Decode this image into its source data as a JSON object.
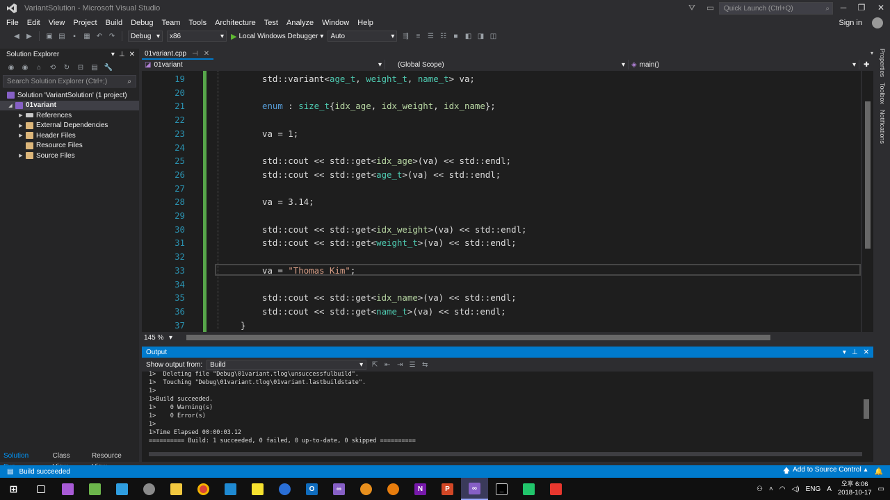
{
  "window": {
    "title": "VariantSolution - Microsoft Visual Studio",
    "quick_launch_placeholder": "Quick Launch (Ctrl+Q)",
    "sign_in": "Sign in"
  },
  "menu": [
    "File",
    "Edit",
    "View",
    "Project",
    "Build",
    "Debug",
    "Team",
    "Tools",
    "Architecture",
    "Test",
    "Analyze",
    "Window",
    "Help"
  ],
  "toolbar": {
    "configuration": "Debug",
    "platform": "x86",
    "debugger": "Local Windows Debugger",
    "debug_mode": "Auto"
  },
  "solution_explorer": {
    "title": "Solution Explorer",
    "search_placeholder": "Search Solution Explorer (Ctrl+;)",
    "solution": "Solution 'VariantSolution' (1 project)",
    "project": "01variant",
    "items": [
      "References",
      "External Dependencies",
      "Header Files",
      "Resource Files",
      "Source Files"
    ],
    "bottom_tabs": [
      "Solution Exp...",
      "Class View",
      "Resource View"
    ]
  },
  "editor": {
    "tab": "01variant.cpp",
    "nav_project": "01variant",
    "nav_scope": "(Global Scope)",
    "nav_function": "main()",
    "zoom": "145 %",
    "lines": [
      {
        "n": "19",
        "t": "std::variant<age_t, weight_t, name_t> va;"
      },
      {
        "n": "20",
        "t": ""
      },
      {
        "n": "21",
        "t": "enum : size_t{idx_age, idx_weight, idx_name};"
      },
      {
        "n": "22",
        "t": ""
      },
      {
        "n": "23",
        "t": "va = 1;"
      },
      {
        "n": "24",
        "t": ""
      },
      {
        "n": "25",
        "t": "std::cout << std::get<idx_age>(va) << std::endl;"
      },
      {
        "n": "26",
        "t": "std::cout << std::get<age_t>(va) << std::endl;"
      },
      {
        "n": "27",
        "t": ""
      },
      {
        "n": "28",
        "t": "va = 3.14;"
      },
      {
        "n": "29",
        "t": ""
      },
      {
        "n": "30",
        "t": "std::cout << std::get<idx_weight>(va) << std::endl;"
      },
      {
        "n": "31",
        "t": "std::cout << std::get<weight_t>(va) << std::endl;"
      },
      {
        "n": "32",
        "t": ""
      },
      {
        "n": "33",
        "t": "va = \"Thomas Kim\";"
      },
      {
        "n": "34",
        "t": ""
      },
      {
        "n": "35",
        "t": "std::cout << std::get<idx_name>(va) << std::endl;"
      },
      {
        "n": "36",
        "t": "std::cout << std::get<name_t>(va) << std::endl;"
      },
      {
        "n": "37",
        "t": "}"
      }
    ]
  },
  "output": {
    "title": "Output",
    "show_from_label": "Show output from:",
    "source": "Build",
    "lines": [
      "1>  Deleting file \"Debug\\01variant.tlog\\unsuccessfulbuild\".",
      "1>  Touching \"Debug\\01variant.tlog\\01variant.lastbuildstate\".",
      "1>",
      "1>Build succeeded.",
      "1>    0 Warning(s)",
      "1>    0 Error(s)",
      "1>",
      "1>Time Elapsed 00:00:03.12",
      "========== Build: 1 succeeded, 0 failed, 0 up-to-date, 0 skipped =========="
    ]
  },
  "side_tabs": [
    "Properties",
    "Toolbox",
    "Notifications"
  ],
  "status": {
    "message": "Build succeeded",
    "source_control": "Add to Source Control"
  },
  "tray": {
    "lang": "ENG",
    "time": "오후 6:06",
    "date": "2018-10-17"
  },
  "colors": {
    "accent": "#007acc",
    "keyword": "#569cd6",
    "type": "#4ec9b0",
    "string": "#d69d85",
    "line_number": "#2b91af",
    "change_bar": "#57a64a"
  }
}
